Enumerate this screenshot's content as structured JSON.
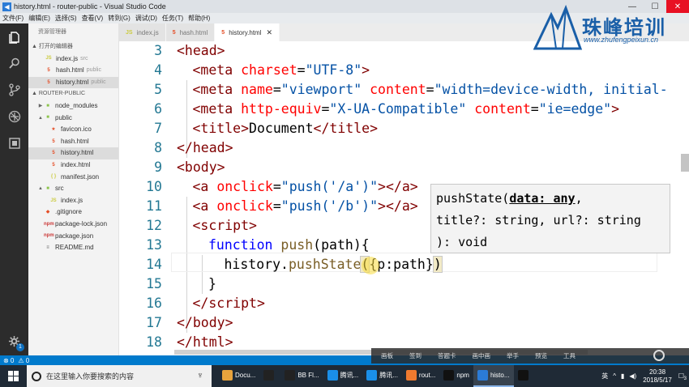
{
  "window": {
    "title": "history.html - router-public - Visual Studio Code",
    "app_icon": "vscode-icon",
    "controls": {
      "minimize": "—",
      "maximize": "☐",
      "close": "✕"
    }
  },
  "menu": [
    "文件(F)",
    "编辑(E)",
    "选择(S)",
    "查看(V)",
    "转到(G)",
    "调试(D)",
    "任务(T)",
    "帮助(H)"
  ],
  "sidebar": {
    "title": "资源管理器",
    "open_editors_label": "▲ 打开的编辑器",
    "open_editors": [
      {
        "icon": "JS",
        "icon_color": "#cbcb41",
        "name": "index.js",
        "hint": "src"
      },
      {
        "icon": "5",
        "icon_color": "#e44d26",
        "name": "hash.html",
        "hint": "public"
      },
      {
        "icon": "5",
        "icon_color": "#e44d26",
        "name": "history.html",
        "hint": "public",
        "selected": true
      }
    ],
    "root_label": "▲ ROUTER-PUBLIC",
    "tree": [
      {
        "depth": 1,
        "twisty": "▶",
        "icon": "■",
        "icon_color": "#8bc34a",
        "name": "node_modules"
      },
      {
        "depth": 1,
        "twisty": "▲",
        "icon": "■",
        "icon_color": "#8bc34a",
        "name": "public"
      },
      {
        "depth": 2,
        "icon": "★",
        "icon_color": "#e44d26",
        "name": "favicon.ico"
      },
      {
        "depth": 2,
        "icon": "5",
        "icon_color": "#e44d26",
        "name": "hash.html"
      },
      {
        "depth": 2,
        "icon": "5",
        "icon_color": "#e44d26",
        "name": "history.html",
        "selected": true
      },
      {
        "depth": 2,
        "icon": "5",
        "icon_color": "#e44d26",
        "name": "index.html"
      },
      {
        "depth": 2,
        "icon": "{ }",
        "icon_color": "#cbcb41",
        "name": "manifest.json"
      },
      {
        "depth": 1,
        "twisty": "▲",
        "icon": "■",
        "icon_color": "#8bc34a",
        "name": "src"
      },
      {
        "depth": 2,
        "icon": "JS",
        "icon_color": "#cbcb41",
        "name": "index.js"
      },
      {
        "depth": 1,
        "icon": "◆",
        "icon_color": "#e44d26",
        "name": ".gitignore"
      },
      {
        "depth": 1,
        "icon": "npm",
        "icon_color": "#cb3837",
        "name": "package-lock.json"
      },
      {
        "depth": 1,
        "icon": "npm",
        "icon_color": "#cb3837",
        "name": "package.json"
      },
      {
        "depth": 1,
        "icon": "≡",
        "icon_color": "#666666",
        "name": "README.md"
      }
    ]
  },
  "activity": {
    "settings_badge": "1"
  },
  "tabs": [
    {
      "icon": "JS",
      "icon_color": "#cbcb41",
      "label": "index.js"
    },
    {
      "icon": "5",
      "icon_color": "#e44d26",
      "label": "hash.html"
    },
    {
      "icon": "5",
      "icon_color": "#e44d26",
      "label": "history.html",
      "active": true,
      "close": "✕"
    }
  ],
  "editor": {
    "lines": [
      {
        "n": "3",
        "indent": 0,
        "html": "<span class=\"t\">&lt;head&gt;</span>"
      },
      {
        "n": "4",
        "indent": 1,
        "html": "<span class=\"t\">&lt;meta</span> <span class=\"a\">charset</span>=<span class=\"s\">\"UTF-8\"</span><span class=\"t\">&gt;</span>"
      },
      {
        "n": "5",
        "indent": 1,
        "html": "<span class=\"t\">&lt;meta</span> <span class=\"a\">name</span>=<span class=\"s\">\"viewport\"</span> <span class=\"a\">content</span>=<span class=\"s\">\"width=device-width, initial-</span>"
      },
      {
        "n": "6",
        "indent": 1,
        "html": "<span class=\"t\">&lt;meta</span> <span class=\"a\">http-equiv</span>=<span class=\"s\">\"X-UA-Compatible\"</span> <span class=\"a\">content</span>=<span class=\"s\">\"ie=edge\"</span><span class=\"t\">&gt;</span>"
      },
      {
        "n": "7",
        "indent": 1,
        "html": "<span class=\"t\">&lt;title&gt;</span>Document<span class=\"t\">&lt;/title&gt;</span>"
      },
      {
        "n": "8",
        "indent": 0,
        "html": "<span class=\"t\">&lt;/head&gt;</span>"
      },
      {
        "n": "9",
        "indent": 0,
        "html": "<span class=\"t\">&lt;body&gt;</span>"
      },
      {
        "n": "10",
        "indent": 1,
        "html": "<span class=\"t\">&lt;a</span> <span class=\"a\">onclick</span>=<span class=\"s\">\"push('/a')\"</span><span class=\"t\">&gt;&lt;/a&gt;</span>"
      },
      {
        "n": "11",
        "indent": 1,
        "html": "<span class=\"t\">&lt;a</span> <span class=\"a\">onclick</span>=<span class=\"s\">\"push('/b')\"</span><span class=\"t\">&gt;&lt;/a&gt;</span>"
      },
      {
        "n": "12",
        "indent": 1,
        "html": "<span class=\"t\">&lt;script&gt;</span>"
      },
      {
        "n": "13",
        "indent": 2,
        "html": "<span class=\"k\">function</span> <span class=\"f\">push</span>(path){"
      },
      {
        "n": "14",
        "indent": 3,
        "html": "history.<span class=\"f\">pushState</span><span class=\"bm\">(</span>{p:path}<span class=\"bm\">)</span>"
      },
      {
        "n": "15",
        "indent": 2,
        "html": "}"
      },
      {
        "n": "16",
        "indent": 1,
        "html": "<span class=\"t\">&lt;/script&gt;</span>"
      },
      {
        "n": "17",
        "indent": 0,
        "html": "<span class=\"t\">&lt;/body&gt;</span>"
      },
      {
        "n": "18",
        "indent": 0,
        "html": "<span class=\"t\">&lt;/html&gt;</span>"
      }
    ],
    "hover": {
      "fn": "pushState(",
      "param_active": "data: any",
      "rest": ",\ntitle?: string, url?: string\n): void"
    }
  },
  "logo": {
    "text": "珠峰培训",
    "url": "www.zhufengpeixun.cn"
  },
  "statusbar": {
    "errors": "⊗ 0",
    "warnings": "⚠ 0"
  },
  "player": [
    "画板",
    "签到",
    "答题卡",
    "画中画",
    "举手",
    "预览",
    "工具"
  ],
  "taskbar": {
    "search_placeholder": "在这里输入你要搜索的内容",
    "items": [
      {
        "icon": "chrome-icon",
        "icon_color": "#e8a33d",
        "label": "Docu..."
      },
      {
        "icon": "qq-icon",
        "icon_color": "#222222",
        "label": ""
      },
      {
        "icon": "feiq-icon",
        "icon_color": "#222222",
        "label": "BB Fl..."
      },
      {
        "icon": "tencent-icon",
        "icon_color": "#1a8fe8",
        "label": "腾讯..."
      },
      {
        "icon": "tencent-icon",
        "icon_color": "#1a8fe8",
        "label": "腾讯..."
      },
      {
        "icon": "postman-icon",
        "icon_color": "#ef7a2f",
        "label": "rout..."
      },
      {
        "icon": "terminal-icon",
        "icon_color": "#111111",
        "label": "npm"
      },
      {
        "icon": "vscode-icon",
        "icon_color": "#2b7bd6",
        "label": "histo...",
        "active": true
      },
      {
        "icon": "m-icon",
        "icon_color": "#111111",
        "label": ""
      }
    ],
    "time": "20:38",
    "date": "2018/5/17",
    "ime": "英",
    "notification_badge": "3"
  }
}
